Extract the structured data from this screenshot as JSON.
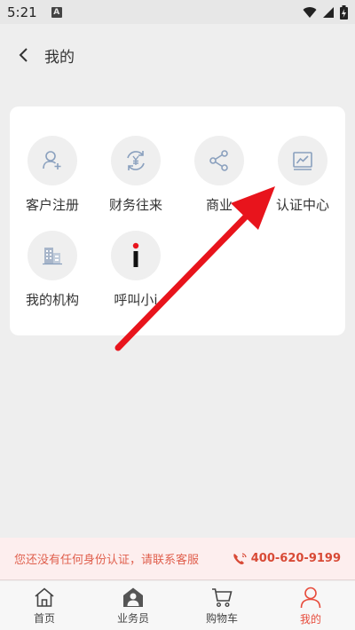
{
  "status_bar": {
    "time": "5:21",
    "notification_letter": "A"
  },
  "header": {
    "title": "我的"
  },
  "menu": {
    "items": [
      {
        "label": "客户注册",
        "icon": "user-add-icon"
      },
      {
        "label": "财务往来",
        "icon": "currency-exchange-icon"
      },
      {
        "label": "商业",
        "icon": "share-icon"
      },
      {
        "label": "认证中心",
        "icon": "chart-monitor-icon"
      },
      {
        "label": "我的机构",
        "icon": "building-icon"
      },
      {
        "label": "呼叫小i",
        "icon": "info-i-icon"
      }
    ]
  },
  "notice": {
    "text": "您还没有任何身份认证，请联系客服",
    "phone": "400-620-9199"
  },
  "tabbar": {
    "tabs": [
      {
        "label": "首页",
        "active": false
      },
      {
        "label": "业务员",
        "active": false
      },
      {
        "label": "购物车",
        "active": false
      },
      {
        "label": "我的",
        "active": true
      }
    ]
  },
  "colors": {
    "accent": "#e74c3c",
    "annotation_arrow": "#e8141c",
    "notice_bg": "#fdeeee",
    "icon_blue": "#8aa0be"
  }
}
